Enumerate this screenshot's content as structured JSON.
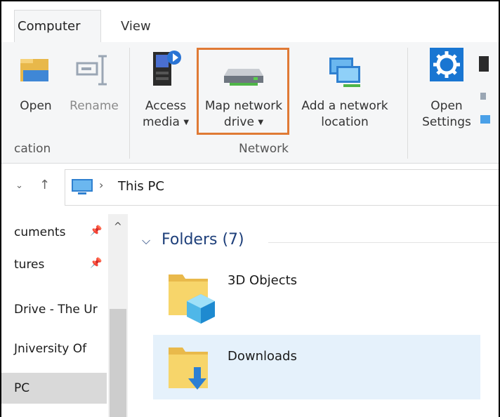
{
  "tabs": {
    "computer": "Computer",
    "view": "View"
  },
  "ribbon": {
    "open": "Open",
    "rename": "Rename",
    "access_media_line1": "Access",
    "access_media_line2": "media",
    "map_network_line1": "Map network",
    "map_network_line2": "drive",
    "add_network_line1": "Add a network",
    "add_network_line2": "location",
    "open_settings_line1": "Open",
    "open_settings_line2": "Settings",
    "group_location": "cation",
    "group_network": "Network",
    "highlight_color": "#e07a35"
  },
  "address": {
    "path": "This PC"
  },
  "nav": {
    "items": [
      "cuments",
      "tures",
      "Drive - The Ur",
      "Jniversity Of",
      "PC"
    ]
  },
  "content": {
    "section_title": "Folders (7)",
    "folders": [
      "3D Objects",
      "Downloads"
    ]
  }
}
